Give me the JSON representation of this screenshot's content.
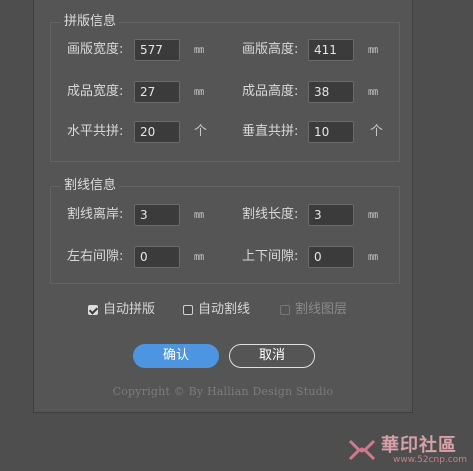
{
  "layout_group": {
    "title": "拼版信息",
    "board_width": {
      "label": "画版宽度:",
      "value": "577",
      "unit": "㎜"
    },
    "board_height": {
      "label": "画版高度:",
      "value": "411",
      "unit": "㎜"
    },
    "product_width": {
      "label": "成品宽度:",
      "value": "27",
      "unit": "㎜"
    },
    "product_height": {
      "label": "成品高度:",
      "value": "38",
      "unit": "㎜"
    },
    "horizontal_count": {
      "label": "水平共拼:",
      "value": "20",
      "unit": "个"
    },
    "vertical_count": {
      "label": "垂直共拼:",
      "value": "10",
      "unit": "个"
    }
  },
  "cutline_group": {
    "title": "割线信息",
    "offset": {
      "label": "割线离岸:",
      "value": "3",
      "unit": "㎜"
    },
    "length": {
      "label": "割线长度:",
      "value": "3",
      "unit": "㎜"
    },
    "h_gap": {
      "label": "左右间隙:",
      "value": "0",
      "unit": "㎜"
    },
    "v_gap": {
      "label": "上下间隙:",
      "value": "0",
      "unit": "㎜"
    }
  },
  "options": {
    "auto_layout": {
      "label": "自动拼版",
      "checked": true
    },
    "auto_cutline": {
      "label": "自动割线",
      "checked": false
    },
    "cutline_layer": {
      "label": "割线图层",
      "checked": false,
      "disabled": true
    }
  },
  "buttons": {
    "ok": "确认",
    "cancel": "取消"
  },
  "copyright": "Copyright © By Hallian Design Studio",
  "watermark": {
    "text": "華印社區",
    "sub": "www.52cnp.com"
  },
  "colors": {
    "panel": "#555555",
    "background": "#4e4e4e",
    "primary": "#4d95e0"
  }
}
